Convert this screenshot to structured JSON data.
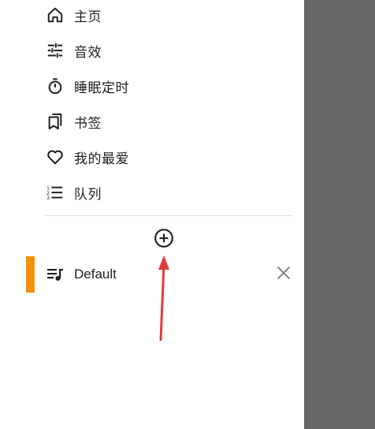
{
  "menu": {
    "items": [
      {
        "label": "主页",
        "icon": "home-icon"
      },
      {
        "label": "音效",
        "icon": "equalizer-icon"
      },
      {
        "label": "睡眠定时",
        "icon": "timer-icon"
      },
      {
        "label": "书签",
        "icon": "bookmarks-icon"
      },
      {
        "label": "我的最爱",
        "icon": "heart-icon"
      },
      {
        "label": "队列",
        "icon": "queue-icon"
      }
    ]
  },
  "playlists": {
    "add_icon": "add-circle-icon",
    "items": [
      {
        "label": "Default",
        "icon": "playlist-music-icon",
        "active": true,
        "remove_icon": "close-icon"
      }
    ]
  },
  "colors": {
    "active_indicator": "#f39100",
    "scrim": "#666666",
    "annotation_arrow": "#e03c3c",
    "text": "#222222"
  }
}
